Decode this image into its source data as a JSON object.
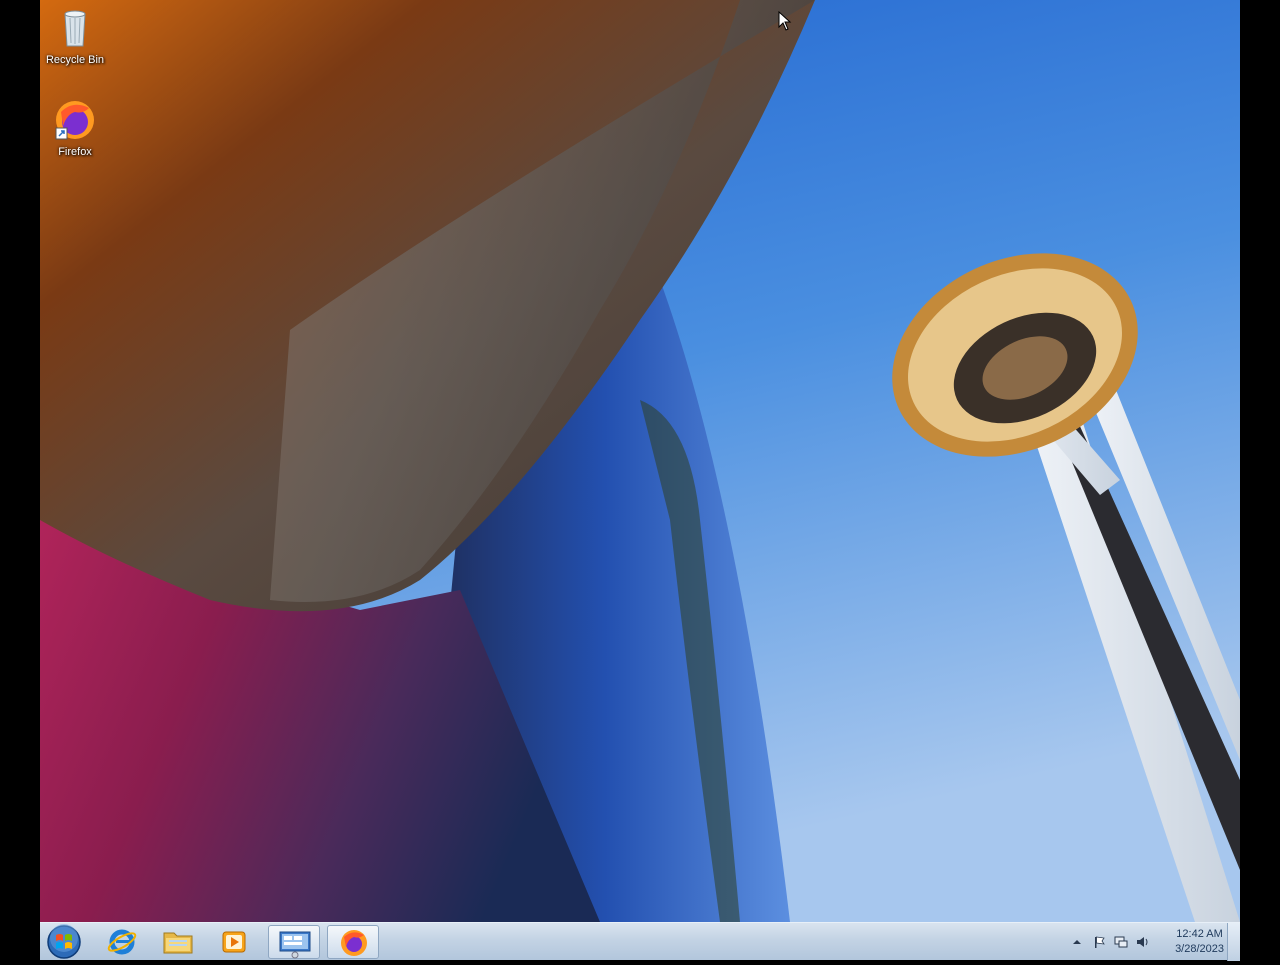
{
  "desktop": {
    "icons": [
      {
        "label": "Recycle Bin",
        "icon": "recycle-bin-icon"
      },
      {
        "label": "Firefox",
        "icon": "firefox-icon"
      }
    ]
  },
  "taskbar": {
    "pinned": [
      {
        "name": "Internet Explorer",
        "icon": "internet-explorer-icon"
      },
      {
        "name": "Windows Explorer",
        "icon": "folder-icon"
      },
      {
        "name": "Windows Media Player",
        "icon": "media-player-icon"
      },
      {
        "name": "Remote Desktop",
        "icon": "remote-desktop-icon",
        "active": true
      },
      {
        "name": "Firefox",
        "icon": "firefox-icon",
        "active": true
      }
    ]
  },
  "tray": {
    "time": "12:42 AM",
    "date": "3/28/2023"
  }
}
